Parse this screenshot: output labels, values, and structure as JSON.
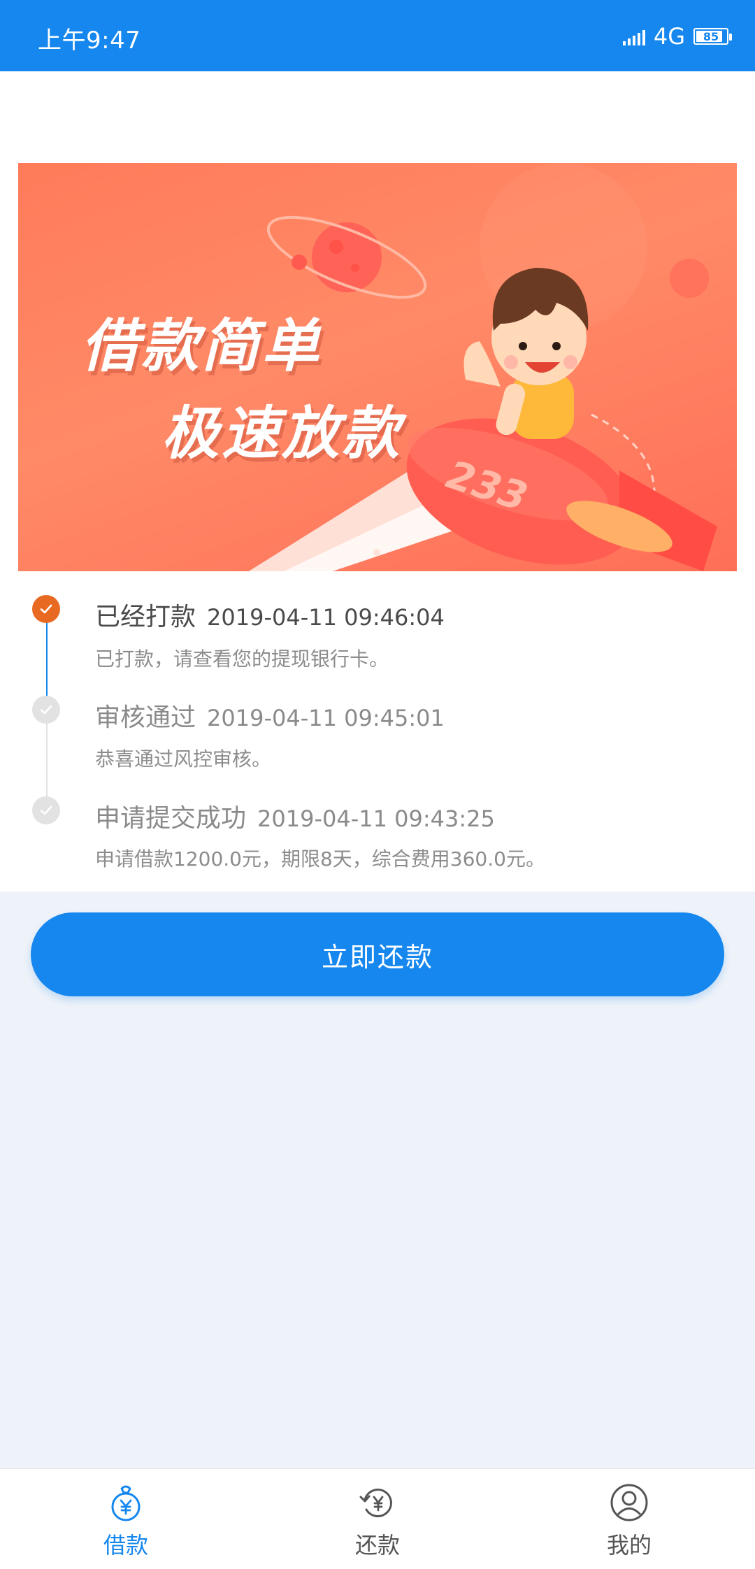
{
  "status_bar": {
    "time": "上午9:47",
    "network": "4G",
    "battery": "85"
  },
  "banner": {
    "slogan_line1": "借款简单",
    "slogan_line2": "极速放款",
    "rocket_number": "233"
  },
  "timeline": [
    {
      "title": "已经打款",
      "timestamp": "2019-04-11 09:46:04",
      "description": "已打款，请查看您的提现银行卡。",
      "state": "active"
    },
    {
      "title": "审核通过",
      "timestamp": "2019-04-11 09:45:01",
      "description": "恭喜通过风控审核。",
      "state": "done"
    },
    {
      "title": "申请提交成功",
      "timestamp": "2019-04-11 09:43:25",
      "description": "申请借款1200.0元，期限8天，综合费用360.0元。",
      "state": "done"
    }
  ],
  "repay_button": "立即还款",
  "tabs": [
    {
      "label": "借款",
      "icon": "money-bag-icon",
      "active": true
    },
    {
      "label": "还款",
      "icon": "repay-cycle-icon",
      "active": false
    },
    {
      "label": "我的",
      "icon": "user-profile-icon",
      "active": false
    }
  ],
  "colors": {
    "primary": "#1587ee",
    "active_step": "#e86a22",
    "inactive_step": "#e2e2e2",
    "page_bg": "#eef2f9",
    "banner_bg": "#ff7b5a"
  }
}
